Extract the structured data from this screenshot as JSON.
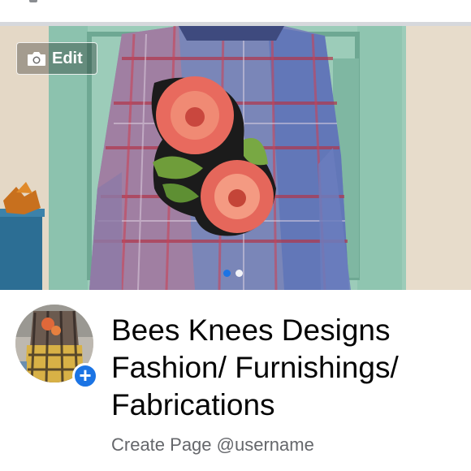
{
  "cover": {
    "edit_label": "Edit",
    "camera_icon": "camera-icon",
    "pager_count": 2,
    "pager_active": 0
  },
  "profile": {
    "add_icon": "plus-icon",
    "add_symbol": "+"
  },
  "page_name": {
    "line1": "Bees Knees Designs",
    "line2": "Fashion/ Furnishings/",
    "line3": "Fabrications"
  },
  "username_link": "Create Page @username",
  "colors": {
    "accent_blue": "#1b74e4",
    "text_primary": "#050505",
    "text_secondary": "#65676b",
    "door_teal": "#8fc7b2"
  }
}
